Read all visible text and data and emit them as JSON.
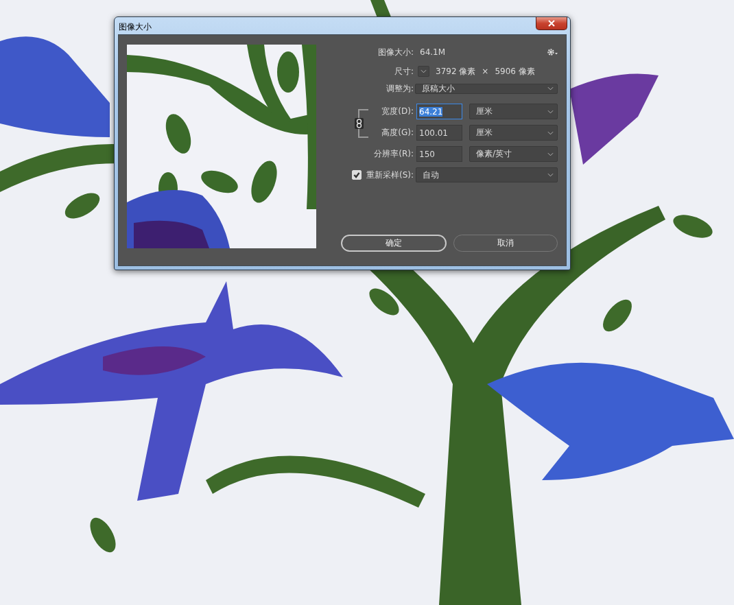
{
  "window": {
    "title": "图像大小"
  },
  "image_size": {
    "label": "图像大小:",
    "value": "64.1M"
  },
  "dimensions": {
    "label": "尺寸:",
    "width": "3792 像素",
    "separator": "×",
    "height": "5906 像素"
  },
  "fit_to": {
    "label": "调整为:",
    "value": "原稿大小"
  },
  "constrain_proportions": {
    "on": true
  },
  "fields": [
    {
      "label": "宽度(D):",
      "value": "64.21",
      "selected": true,
      "unit": "厘米"
    },
    {
      "label": "高度(G):",
      "value": "100.01",
      "selected": false,
      "unit": "厘米"
    },
    {
      "label": "分辨率(R):",
      "value": "150",
      "selected": false,
      "unit": "像素/英寸"
    }
  ],
  "resample": {
    "label": "重新采样(S):",
    "checked": true,
    "value": "自动"
  },
  "buttons": [
    {
      "label": "确定",
      "default": true
    },
    {
      "label": "取消",
      "default": false
    }
  ]
}
